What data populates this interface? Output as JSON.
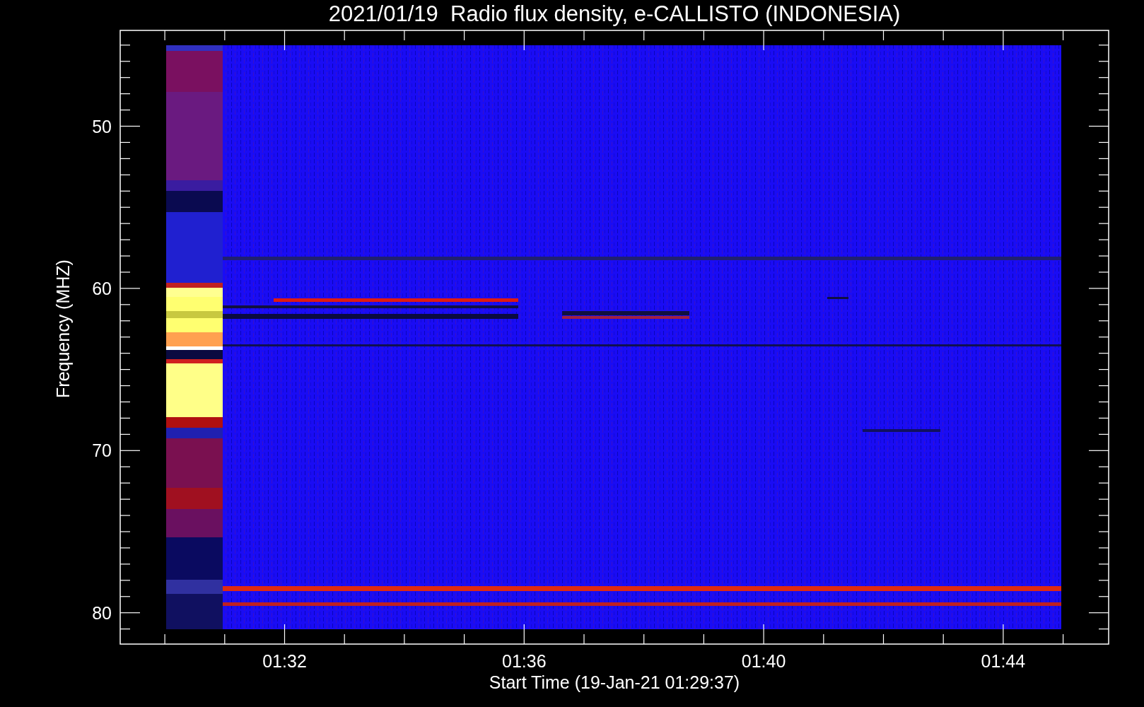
{
  "title": "2021/01/19  Radio flux density, e-CALLISTO (INDONESIA)",
  "y_axis": {
    "label": "Frequency (MHZ)",
    "ticks": [
      "50",
      "60",
      "70",
      "80"
    ]
  },
  "x_axis": {
    "label": "Start Time (19-Jan-21 01:29:37)",
    "ticks": [
      "01:32",
      "01:36",
      "01:40",
      "01:44"
    ]
  }
}
